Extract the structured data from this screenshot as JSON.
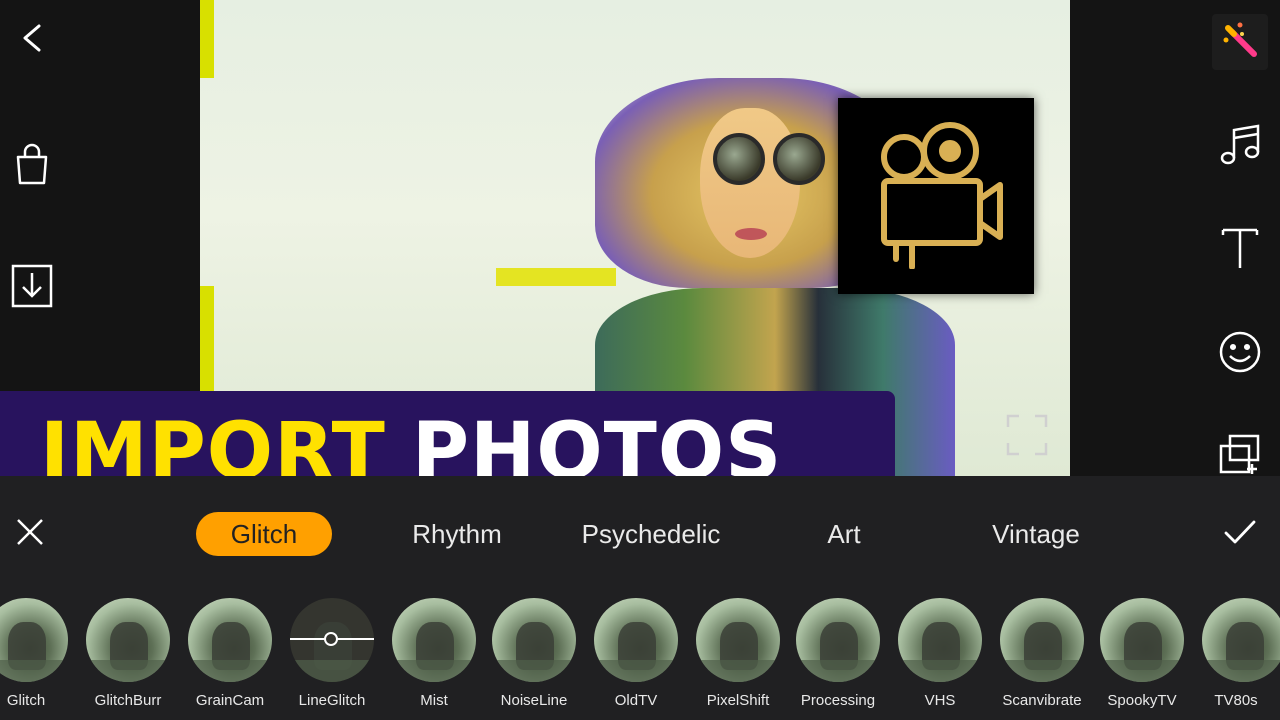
{
  "banner": {
    "word1": "IMPORT",
    "word2": "PHOTOS",
    "word1_color": "#ffe100",
    "word2_color": "#ffffff",
    "bg_color": "#28135e"
  },
  "left_toolbar": {
    "icons": [
      "back-arrow-icon",
      "shopping-bag-icon",
      "download-icon"
    ]
  },
  "right_toolbar": {
    "icons": [
      "magic-wand-icon",
      "music-note-icon",
      "text-icon",
      "smiley-icon",
      "add-overlay-icon"
    ]
  },
  "preview": {
    "overlay_logo": "film-camera-icon",
    "fullscreen_icon": "fullscreen-icon"
  },
  "effects_panel": {
    "tabs": [
      {
        "label": "Glitch",
        "active": true
      },
      {
        "label": "Rhythm",
        "active": false
      },
      {
        "label": "Psychedelic",
        "active": false
      },
      {
        "label": "Art",
        "active": false
      },
      {
        "label": "Vintage",
        "active": false
      }
    ],
    "accent_color": "#ffa000",
    "close_icon": "close-icon",
    "confirm_icon": "checkmark-icon",
    "filters": [
      {
        "label": "Glitch"
      },
      {
        "label": "GlitchBurr"
      },
      {
        "label": "GrainCam"
      },
      {
        "label": "LineGlitch",
        "selected": true
      },
      {
        "label": "Mist"
      },
      {
        "label": "NoiseLine"
      },
      {
        "label": "OldTV"
      },
      {
        "label": "PixelShift"
      },
      {
        "label": "Processing"
      },
      {
        "label": "VHS"
      },
      {
        "label": "Scanvibrate"
      },
      {
        "label": "SpookyTV"
      },
      {
        "label": "TV80s"
      }
    ]
  }
}
